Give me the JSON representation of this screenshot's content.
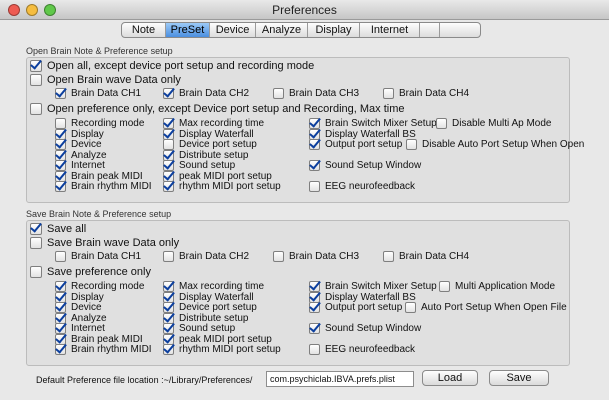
{
  "window": {
    "title": "Preferences"
  },
  "tabs": [
    {
      "label": "Note",
      "selected": false
    },
    {
      "label": "PreSet",
      "selected": true
    },
    {
      "label": "Device",
      "selected": false
    },
    {
      "label": "Analyze",
      "selected": false
    },
    {
      "label": "Display",
      "selected": false
    },
    {
      "label": "Internet",
      "selected": false
    },
    {
      "label": "",
      "selected": false
    },
    {
      "label": "",
      "selected": false
    }
  ],
  "open_section": {
    "title": "Open Brain Note & Preference setup",
    "open_all": {
      "label": "Open all, except device port setup and recording mode",
      "checked": true
    },
    "brain_wave": {
      "label": "Open Brain wave Data only",
      "checked": false
    },
    "channels": [
      {
        "label": "Brain Data CH1",
        "checked": true
      },
      {
        "label": "Brain Data CH2",
        "checked": true
      },
      {
        "label": "Brain Data CH3",
        "checked": false
      },
      {
        "label": "Brain Data CH4",
        "checked": false
      }
    ],
    "pref_only": {
      "label": "Open preference only, except Device port setup and Recording, Max time",
      "checked": false
    },
    "col1": [
      {
        "label": "Recording mode",
        "checked": false
      },
      {
        "label": "Display",
        "checked": true
      },
      {
        "label": "Device",
        "checked": true
      },
      {
        "label": "Analyze",
        "checked": true
      },
      {
        "label": "Internet",
        "checked": true
      },
      {
        "label": "Brain peak MIDI",
        "checked": true
      },
      {
        "label": "Brain rhythm MIDI",
        "checked": true
      }
    ],
    "col2": [
      {
        "label": "Max recording time",
        "checked": true
      },
      {
        "label": "Display Waterfall",
        "checked": true
      },
      {
        "label": "Device port setup",
        "checked": false
      },
      {
        "label": "Distribute setup",
        "checked": true
      },
      {
        "label": "Sound setup",
        "checked": true
      },
      {
        "label": "peak MIDI port setup",
        "checked": true
      },
      {
        "label": "rhythm MIDI port setup",
        "checked": true
      }
    ],
    "col3": [
      {
        "label": "Brain Switch Mixer Setup",
        "checked": true
      },
      {
        "label": "Display Waterfall BS",
        "checked": true
      },
      {
        "label": "Output port setup",
        "checked": true
      },
      {
        "label": "Sound Setup Window",
        "checked": true
      },
      {
        "label": "EEG neurofeedback",
        "checked": false
      }
    ],
    "col4": [
      {
        "label": "Disable Multi Ap Mode",
        "checked": false
      },
      {
        "label": "Disable Auto Port Setup When Open",
        "checked": false
      }
    ]
  },
  "save_section": {
    "title": "Save Brain Note & Preference setup",
    "save_all": {
      "label": "Save all",
      "checked": true
    },
    "brain_wave": {
      "label": "Save Brain wave Data only",
      "checked": false
    },
    "channels": [
      {
        "label": "Brain Data CH1",
        "checked": false
      },
      {
        "label": "Brain Data CH2",
        "checked": false
      },
      {
        "label": "Brain Data CH3",
        "checked": false
      },
      {
        "label": "Brain Data CH4",
        "checked": false
      }
    ],
    "pref_only": {
      "label": "Save preference only",
      "checked": false
    },
    "col1": [
      {
        "label": "Recording mode",
        "checked": true
      },
      {
        "label": "Display",
        "checked": true
      },
      {
        "label": "Device",
        "checked": true
      },
      {
        "label": "Analyze",
        "checked": true
      },
      {
        "label": "Internet",
        "checked": true
      },
      {
        "label": "Brain peak MIDI",
        "checked": true
      },
      {
        "label": "Brain rhythm MIDI",
        "checked": true
      }
    ],
    "col2": [
      {
        "label": "Max recording time",
        "checked": true
      },
      {
        "label": "Display Waterfall",
        "checked": true
      },
      {
        "label": "Device port setup",
        "checked": true
      },
      {
        "label": "Distribute setup",
        "checked": true
      },
      {
        "label": "Sound setup",
        "checked": true
      },
      {
        "label": "peak MIDI port setup",
        "checked": true
      },
      {
        "label": "rhythm MIDI port setup",
        "checked": true
      }
    ],
    "col3": [
      {
        "label": "Brain Switch Mixer Setup",
        "checked": true
      },
      {
        "label": "Display Waterfall BS",
        "checked": true
      },
      {
        "label": "Output port setup",
        "checked": true
      },
      {
        "label": "Sound Setup Window",
        "checked": true
      },
      {
        "label": "EEG neurofeedback",
        "checked": false
      }
    ],
    "col4": [
      {
        "label": "Multi Application Mode",
        "checked": false
      },
      {
        "label": "Auto Port Setup When Open File",
        "checked": false
      }
    ]
  },
  "footer": {
    "location_label": "Default Preference file location :~/Library/Preferences/",
    "filename": "com.psychiclab.IBVA.prefs.plist",
    "load_label": "Load",
    "save_label": "Save"
  },
  "colors": {
    "accent": "#4b8fe0",
    "check": "#0c3f9e",
    "close": "#ee5b52",
    "minimize": "#f5bd3f",
    "zoom": "#60c84a"
  }
}
